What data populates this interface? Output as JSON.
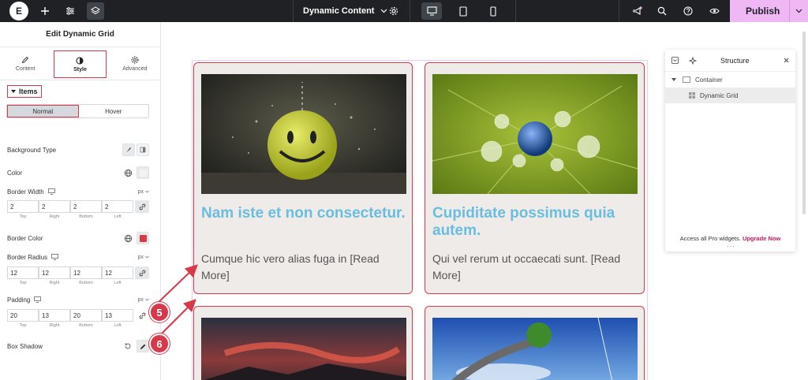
{
  "topbar": {
    "page_title": "Dynamic Content",
    "publish_label": "Publish"
  },
  "panel": {
    "title": "Edit Dynamic Grid",
    "tabs": [
      {
        "label": "Content",
        "icon": "pencil-icon"
      },
      {
        "label": "Style",
        "icon": "half-circle-icon"
      },
      {
        "label": "Advanced",
        "icon": "gear-icon"
      }
    ],
    "section": "Items",
    "state_tabs": [
      "Normal",
      "Hover"
    ],
    "background_type_label": "Background Type",
    "color_label": "Color",
    "border_width": {
      "label": "Border Width",
      "unit": "px",
      "values": [
        "2",
        "2",
        "2",
        "2"
      ]
    },
    "border_color_label": "Border Color",
    "border_color": "#d63a4a",
    "border_radius": {
      "label": "Border Radius",
      "unit": "px",
      "values": [
        "12",
        "12",
        "12",
        "12"
      ]
    },
    "padding": {
      "label": "Padding",
      "unit": "px",
      "values": [
        "20",
        "13",
        "20",
        "13"
      ]
    },
    "side_captions": [
      "Top",
      "Right",
      "Bottom",
      "Left"
    ],
    "box_shadow_label": "Box Shadow"
  },
  "cards": [
    {
      "title": "Nam iste et non consectetur.",
      "text": "Cumque hic vero alias fuga in [Read More]"
    },
    {
      "title": "Cupiditate possimus quia autem.",
      "text": "Qui vel rerum ut occaecati sunt. [Read More]"
    }
  ],
  "structure": {
    "title": "Structure",
    "items": [
      "Container",
      "Dynamic Grid"
    ],
    "footer_text": "Access all Pro widgets.",
    "upgrade_label": "Upgrade Now"
  },
  "annotations": [
    "5",
    "6"
  ],
  "colors": {
    "accent": "#d63a4a",
    "title_blue": "#69bee0",
    "publish_bg": "#f0b7f5"
  }
}
